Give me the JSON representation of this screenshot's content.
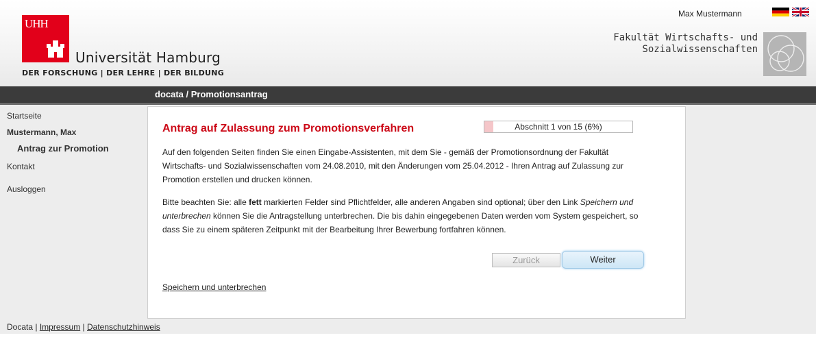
{
  "header": {
    "logo_text": "UHH",
    "university": "Universität Hamburg",
    "tagline": "DER FORSCHUNG | DER LEHRE | DER BILDUNG",
    "user_name": "Max Mustermann",
    "faculty_line1": "Fakultät Wirtschafts- und",
    "faculty_line2": "Sozialwissenschaften",
    "flags": [
      "flag-de-icon",
      "flag-en-icon"
    ]
  },
  "titlebar": {
    "title": "docata / Promotionsantrag"
  },
  "sidebar": {
    "items": [
      {
        "label": "Startseite"
      },
      {
        "label": "Mustermann, Max"
      },
      {
        "label": "Antrag zur Promotion"
      },
      {
        "label": "Kontakt"
      },
      {
        "label": "Ausloggen"
      }
    ]
  },
  "main": {
    "heading": "Antrag auf Zulassung zum Promotionsverfahren",
    "progress": {
      "label": "Abschnitt 1 von 15 (6%)",
      "fraction": 0.06
    },
    "para1": "Auf den folgenden Seiten finden Sie einen Eingabe-Assistenten, mit dem Sie - gemäß der Promotionsordnung der Fakultät Wirtschafts- und Sozialwissenschaften vom 24.08.2010, mit den Änderungen vom 25.04.2012 - Ihren Antrag auf Zulassung zur Promotion erstellen und drucken können.",
    "para2_a": "Bitte beachten Sie: alle ",
    "para2_bold": "fett",
    "para2_b": " markierten Felder sind Pflichtfelder, alle anderen Angaben sind optional; über den Link ",
    "para2_italic": "Speichern und unterbrechen",
    "para2_c": " können Sie die Antragstellung unterbrechen. Die bis dahin eingegebenen Daten werden vom System gespeichert, so dass Sie zu einem späteren Zeitpunkt mit der Bearbeitung Ihrer Bewerbung fortfahren können.",
    "back_label": "Zurück",
    "next_label": "Weiter",
    "save_link": "Speichern und unterbrechen"
  },
  "footer": {
    "brand": "Docata",
    "sep": "|",
    "impressum": "Impressum",
    "datenschutz": "Datenschutzhinweis"
  },
  "colors": {
    "accent": "#cc0a18",
    "titlebar": "#3b3b3b",
    "button": "#cde6f6"
  }
}
